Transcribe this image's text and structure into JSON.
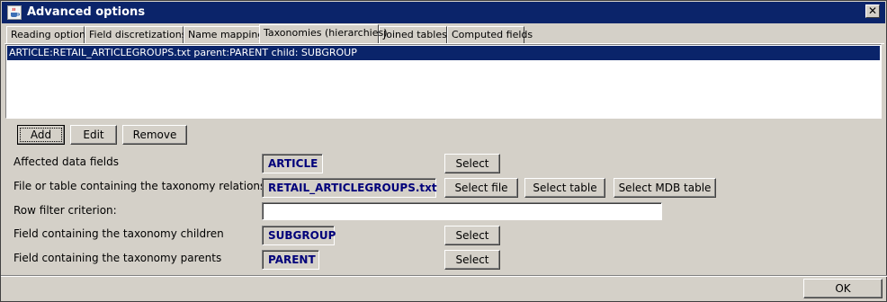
{
  "window": {
    "title": "Advanced options",
    "app_icon": "java-cup-icon",
    "close_label": "✕"
  },
  "tabs": [
    {
      "label": "Reading options"
    },
    {
      "label": "Field discretizations"
    },
    {
      "label": "Name mappings"
    },
    {
      "label": "Taxonomies (hierarchies)"
    },
    {
      "label": "Joined tables"
    },
    {
      "label": "Computed fields"
    }
  ],
  "active_tab": "Taxonomies (hierarchies)",
  "list": {
    "items": [
      "ARTICLE:RETAIL_ARTICLEGROUPS.txt parent:PARENT child: SUBGROUP"
    ]
  },
  "actions": {
    "add": "Add",
    "edit": "Edit",
    "remove": "Remove"
  },
  "form": {
    "affected_fields": {
      "label": "Affected data fields",
      "value": "ARTICLE",
      "select": "Select"
    },
    "taxonomy_file": {
      "label": "File or table containing the taxonomy relations",
      "value": "RETAIL_ARTICLEGROUPS.txt",
      "select_file": "Select file",
      "select_table": "Select table",
      "select_mdb": "Select MDB table"
    },
    "row_filter": {
      "label": "Row filter criterion:",
      "value": ""
    },
    "children_field": {
      "label": "Field containing the taxonomy children",
      "value": "SUBGROUP",
      "select": "Select"
    },
    "parents_field": {
      "label": "Field containing the taxonomy parents",
      "value": "PARENT",
      "select": "Select"
    }
  },
  "footer": {
    "ok": "OK"
  },
  "colors": {
    "titlebar": "#0b246a",
    "selection": "#0a246a",
    "value_text": "#00007a",
    "face": "#d4d0c8"
  }
}
